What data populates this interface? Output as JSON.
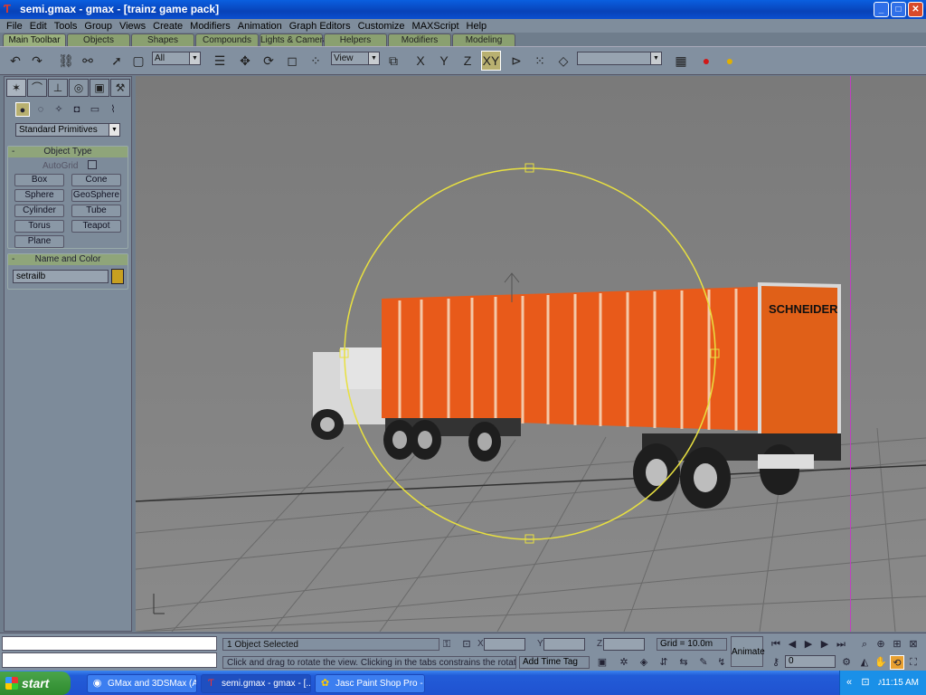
{
  "window": {
    "title": "semi.gmax - gmax - [trainz game pack]"
  },
  "menu": [
    "File",
    "Edit",
    "Tools",
    "Group",
    "Views",
    "Create",
    "Modifiers",
    "Animation",
    "Graph Editors",
    "Customize",
    "MAXScript",
    "Help"
  ],
  "tabs": [
    "Main Toolbar",
    "Objects",
    "Shapes",
    "Compounds",
    "Lights & Cameras",
    "Helpers",
    "Modifiers",
    "Modeling"
  ],
  "toolbar": {
    "selection_filter": "All",
    "coord_system": "View",
    "axis_x": "X",
    "axis_y": "Y",
    "axis_z": "Z",
    "axis_xy": "XY",
    "named_selection": ""
  },
  "panel": {
    "category": "Standard Primitives",
    "object_type": {
      "title": "Object Type",
      "autogrid": "AutoGrid",
      "buttons": [
        "Box",
        "Cone",
        "Sphere",
        "GeoSphere",
        "Cylinder",
        "Tube",
        "Torus",
        "Teapot",
        "Plane"
      ]
    },
    "name_color": {
      "title": "Name and Color",
      "name": "setrailb",
      "color": "#c8a020"
    }
  },
  "status": {
    "selected": "1 Object Selected",
    "x_label": "X",
    "y_label": "Y",
    "z_label": "Z",
    "grid": "Grid = 10.0m",
    "prompt": "Click and drag to rotate the view.  Clicking in the tabs constrains the rotation",
    "time_tag": "Add Time Tag",
    "animate": "Animate",
    "frame": "0"
  },
  "viewport": {
    "trailer_text": "SCHNEIDER",
    "trailer_color": "#e85a1a"
  },
  "taskbar": {
    "start": "start",
    "tasks": [
      "GMax and 3DSMax (A...",
      "semi.gmax - gmax - [...",
      "Jasc Paint Shop Pro - ..."
    ],
    "clock": "11:15 AM"
  }
}
